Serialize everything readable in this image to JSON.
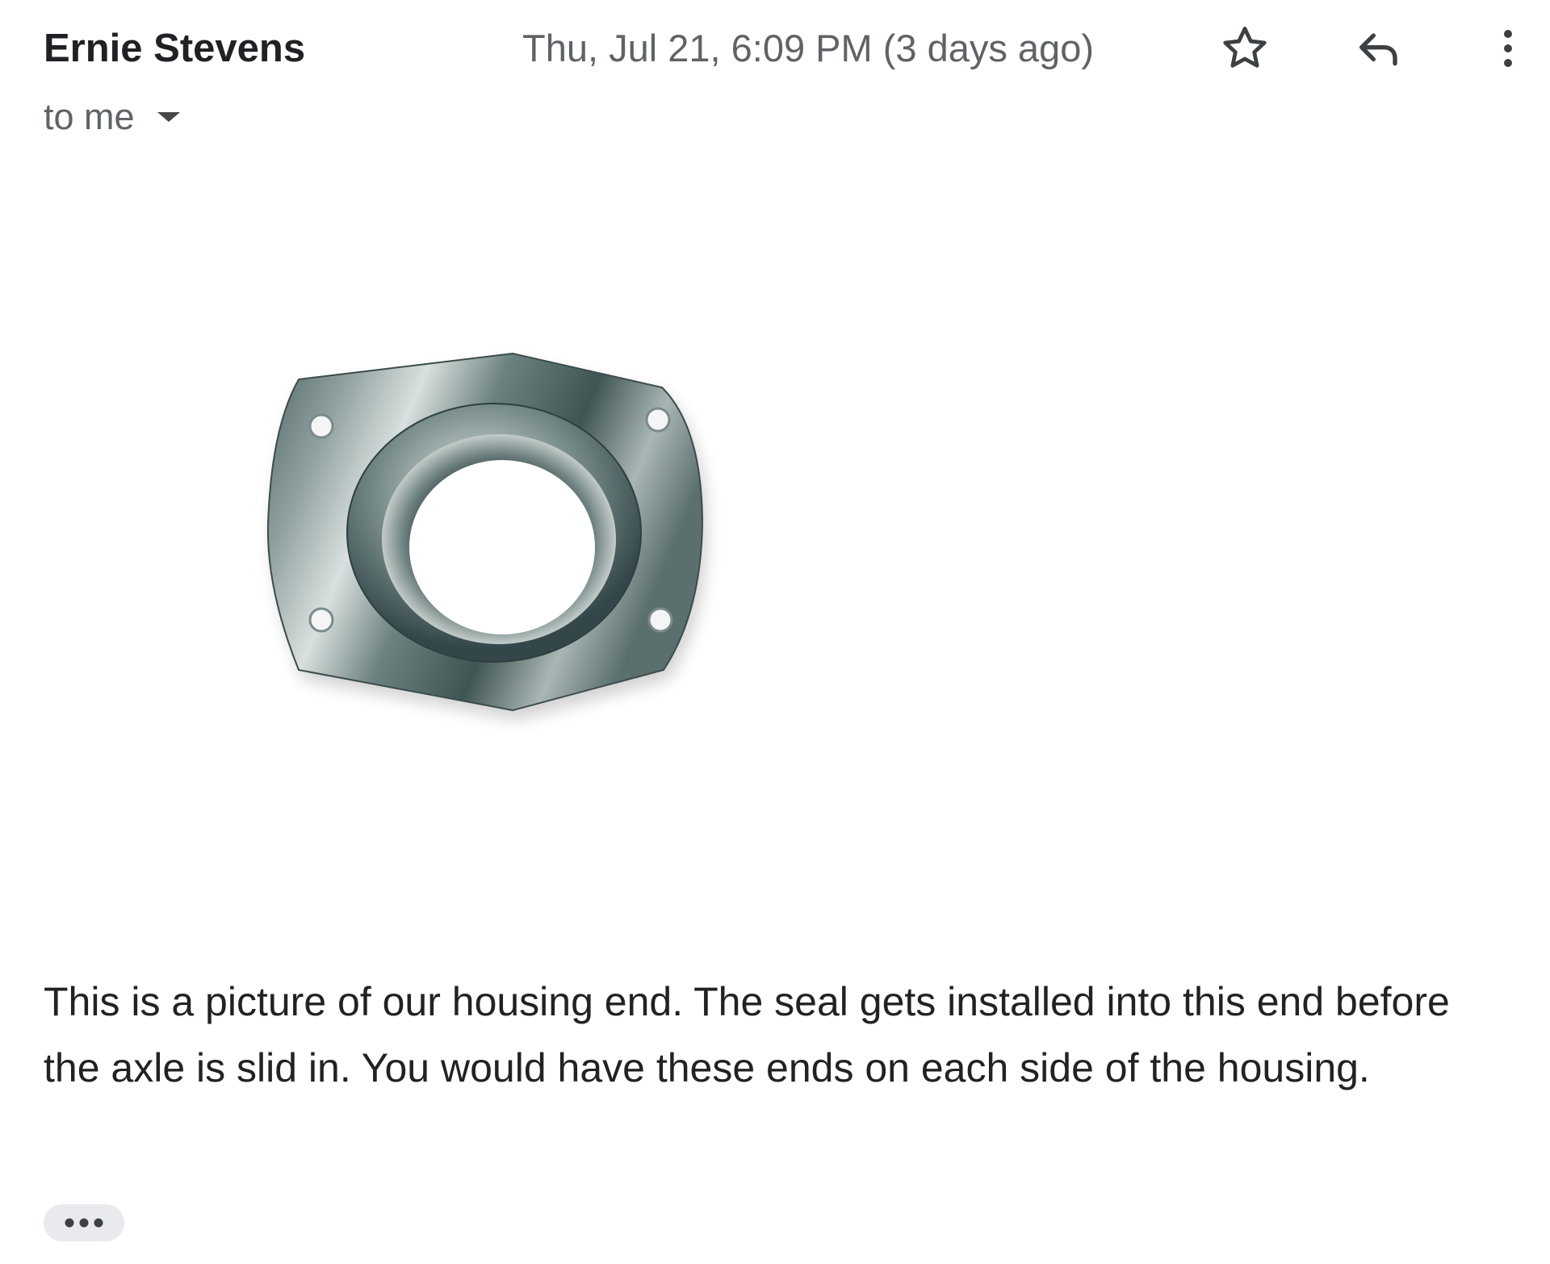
{
  "header": {
    "sender_name": "Ernie Stevens",
    "date": "Thu, Jul 21, 6:09 PM (3 days ago)",
    "recipient": "to me",
    "icons": {
      "star": "star-outline-icon",
      "reply": "reply-arrow-icon",
      "more": "vertical-dots-icon",
      "expand": "caret-down-icon"
    }
  },
  "attachment": {
    "image": "housing-end-flange-photo"
  },
  "message": {
    "body": "This is a picture of our housing end.  The seal gets installed into this end before the axle is slid in.  You would have these ends on each side of the housing."
  },
  "trimmed_content": {
    "icon": "ellipsis-icon"
  },
  "colors": {
    "sender_text": "#202124",
    "meta_text": "#5f6368",
    "body_text": "#222222",
    "chip_bg": "#e8eaed"
  }
}
